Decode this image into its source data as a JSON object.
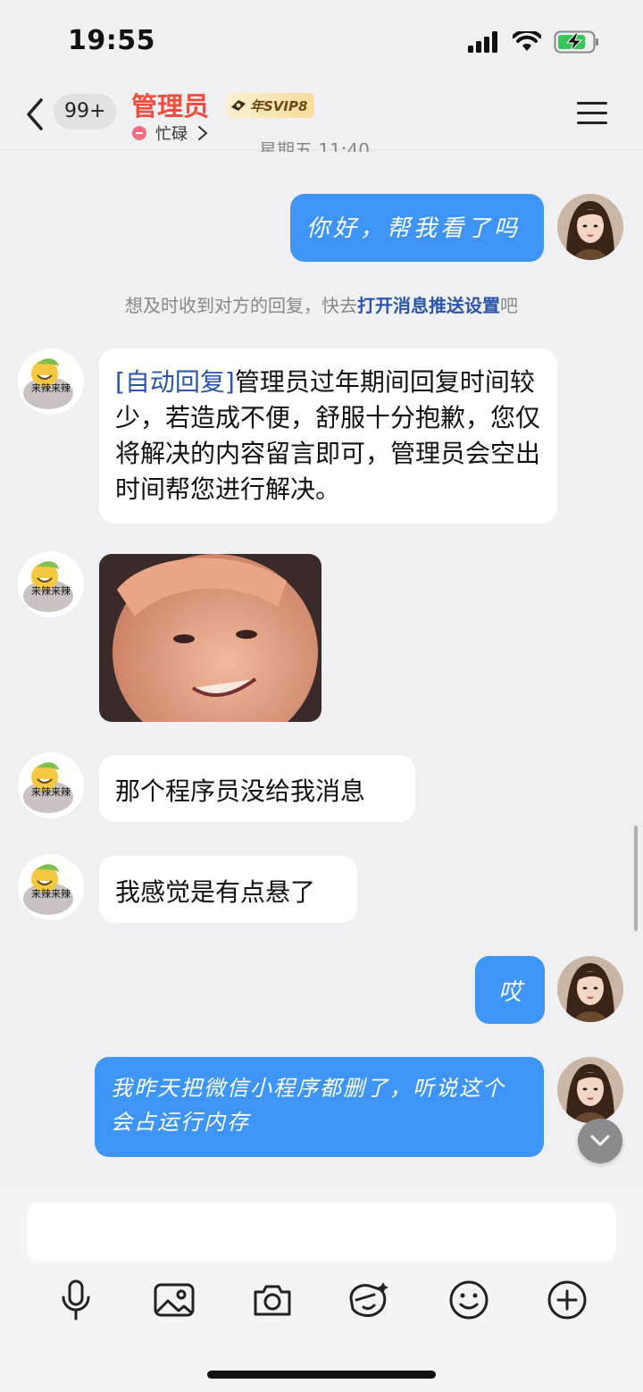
{
  "status_bar": {
    "time": "19:55"
  },
  "header": {
    "back_count": "99+",
    "title": "管理员",
    "vip_label": "年SVIP8",
    "status_text": "忙碌",
    "cut_off_text": "星期五 11:40"
  },
  "messages": [
    {
      "side": "out",
      "text": "你好，帮我看了吗"
    },
    {
      "side": "in",
      "prefix": "[自动回复]",
      "text": "管理员过年期间回复时间较少，若造成不便，舒服十分抱歉，您仅将解决的内容留言即可，管理员会空出时间帮您进行解决。"
    },
    {
      "side": "in",
      "type": "image"
    },
    {
      "side": "in",
      "text": "那个程序员没给我消息"
    },
    {
      "side": "in",
      "text": "我感觉是有点悬了"
    },
    {
      "side": "out",
      "text": "哎"
    },
    {
      "side": "out",
      "text": "我昨天把微信小程序都删了，听说这个会占运行内存"
    }
  ],
  "notice": {
    "before": "想及时收到对方的回复，快去",
    "link": "打开消息推送设置",
    "after": "吧"
  },
  "contact_avatar_text": "来辣来辣",
  "toolbar": [
    "mic-icon",
    "gallery-icon",
    "camera-icon",
    "sticker-icon",
    "emoji-icon",
    "plus-icon"
  ],
  "colors": {
    "accent": "#3f95f5",
    "title": "#f24d3e",
    "link": "#2b55a8"
  }
}
